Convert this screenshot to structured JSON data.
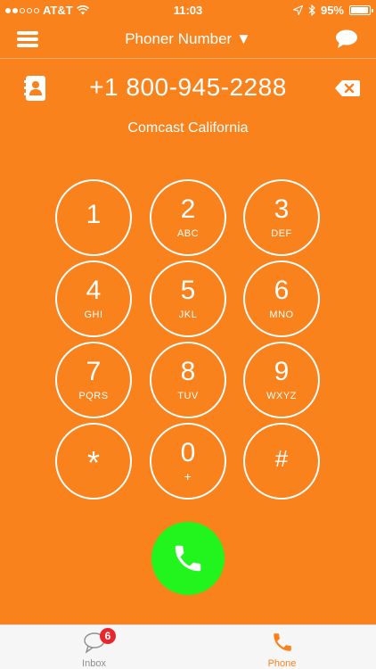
{
  "status_bar": {
    "carrier": "AT&T",
    "time": "11:03",
    "battery_level": 0.95,
    "battery": "95%"
  },
  "nav": {
    "title": "Phoner Number ▼",
    "menu_icon": "hamburger-menu-icon",
    "chat_icon": "chat-bubble-icon"
  },
  "dialer": {
    "number": "+1 800-945-2288",
    "caller_name": "Comcast California",
    "contacts_icon": "contacts-book-icon",
    "backspace_icon": "backspace-icon"
  },
  "keypad": {
    "k1": {
      "digit": "1",
      "letters": ""
    },
    "k2": {
      "digit": "2",
      "letters": "ABC"
    },
    "k3": {
      "digit": "3",
      "letters": "DEF"
    },
    "k4": {
      "digit": "4",
      "letters": "GHI"
    },
    "k5": {
      "digit": "5",
      "letters": "JKL"
    },
    "k6": {
      "digit": "6",
      "letters": "MNO"
    },
    "k7": {
      "digit": "7",
      "letters": "PQRS"
    },
    "k8": {
      "digit": "8",
      "letters": "TUV"
    },
    "k9": {
      "digit": "9",
      "letters": "WXYZ"
    },
    "kstar": {
      "digit": "*",
      "letters": ""
    },
    "k0": {
      "digit": "0",
      "letters": "+"
    },
    "khash": {
      "digit": "#",
      "letters": ""
    }
  },
  "call_button": {
    "icon": "phone-icon",
    "color": "#22f51e"
  },
  "tabs": {
    "inbox": {
      "label": "Inbox",
      "badge": "6",
      "icon": "chat-bubble-icon"
    },
    "phone": {
      "label": "Phone",
      "icon": "phone-icon"
    }
  },
  "colors": {
    "background": "#f9821c",
    "active_tab": "#f9821c",
    "inactive_tab": "#8e8e8e",
    "badge": "#e8262e"
  }
}
